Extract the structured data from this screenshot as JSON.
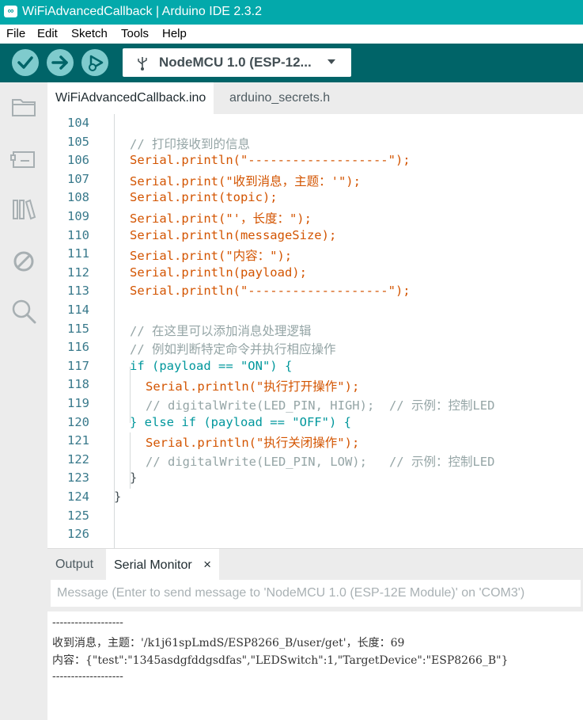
{
  "window": {
    "title": "WiFiAdvancedCallback | Arduino IDE 2.3.2",
    "app_icon": "∞"
  },
  "menu": [
    "File",
    "Edit",
    "Sketch",
    "Tools",
    "Help"
  ],
  "toolbar": {
    "verify_icon": "verify-check-icon",
    "upload_icon": "upload-arrow-icon",
    "debug_icon": "debug-play-icon",
    "board_name": "NodeMCU 1.0 (ESP-12...",
    "usb_icon": "usb-icon"
  },
  "sidebar": [
    "sketchbook-folder-icon",
    "boards-manager-icon",
    "library-manager-icon",
    "debug-icon",
    "search-icon"
  ],
  "tabs": [
    "WiFiAdvancedCallback.ino",
    "arduino_secrets.h"
  ],
  "code_lines": [
    {
      "n": "104",
      "t": ""
    },
    {
      "n": "105",
      "t": "// 打印接收到的信息"
    },
    {
      "n": "106",
      "t": "Serial.println(\"-------------------\");"
    },
    {
      "n": "107",
      "t": "Serial.print(\"收到消息，主题：'\");"
    },
    {
      "n": "108",
      "t": "Serial.print(topic);"
    },
    {
      "n": "109",
      "t": "Serial.print(\"'，长度：\");"
    },
    {
      "n": "110",
      "t": "Serial.println(messageSize);"
    },
    {
      "n": "111",
      "t": "Serial.print(\"内容：\");"
    },
    {
      "n": "112",
      "t": "Serial.println(payload);"
    },
    {
      "n": "113",
      "t": "Serial.println(\"-------------------\");"
    },
    {
      "n": "114",
      "t": ""
    },
    {
      "n": "115",
      "t": "// 在这里可以添加消息处理逻辑"
    },
    {
      "n": "116",
      "t": "// 例如判断特定命令并执行相应操作"
    },
    {
      "n": "117",
      "t": "if (payload == \"ON\") {"
    },
    {
      "n": "118",
      "t": "Serial.println(\"执行打开操作\");"
    },
    {
      "n": "119",
      "t": "// digitalWrite(LED_PIN, HIGH);  // 示例：控制LED"
    },
    {
      "n": "120",
      "t": "} else if (payload == \"OFF\") {"
    },
    {
      "n": "121",
      "t": "Serial.println(\"执行关闭操作\");"
    },
    {
      "n": "122",
      "t": "// digitalWrite(LED_PIN, LOW);   // 示例：控制LED"
    },
    {
      "n": "123",
      "t": "}"
    },
    {
      "n": "124",
      "t": "}"
    },
    {
      "n": "125",
      "t": ""
    },
    {
      "n": "126",
      "t": ""
    }
  ],
  "panel": {
    "output_tab": "Output",
    "serial_tab": "Serial Monitor",
    "close_icon": "×"
  },
  "serial_input": {
    "placeholder": "Message (Enter to send message to 'NodeMCU 1.0 (ESP-12E Module)' on 'COM3')",
    "value": ""
  },
  "serial_output": [
    "-------------------",
    "收到消息，主题：'/k1j61spLmdS/ESP8266_B/user/get'，长度：69",
    "内容：{\"test\":\"1345asdgfddgsdfas\",\"LEDSwitch\":1,\"TargetDevice\":\"ESP8266_B\"}",
    "-------------------"
  ],
  "colors": {
    "titlebar": "#03a9ab",
    "toolbar": "#006468",
    "button": "#7fcbcd",
    "keyword": "#00979c",
    "function": "#d35400",
    "comment": "#95a5a6"
  }
}
